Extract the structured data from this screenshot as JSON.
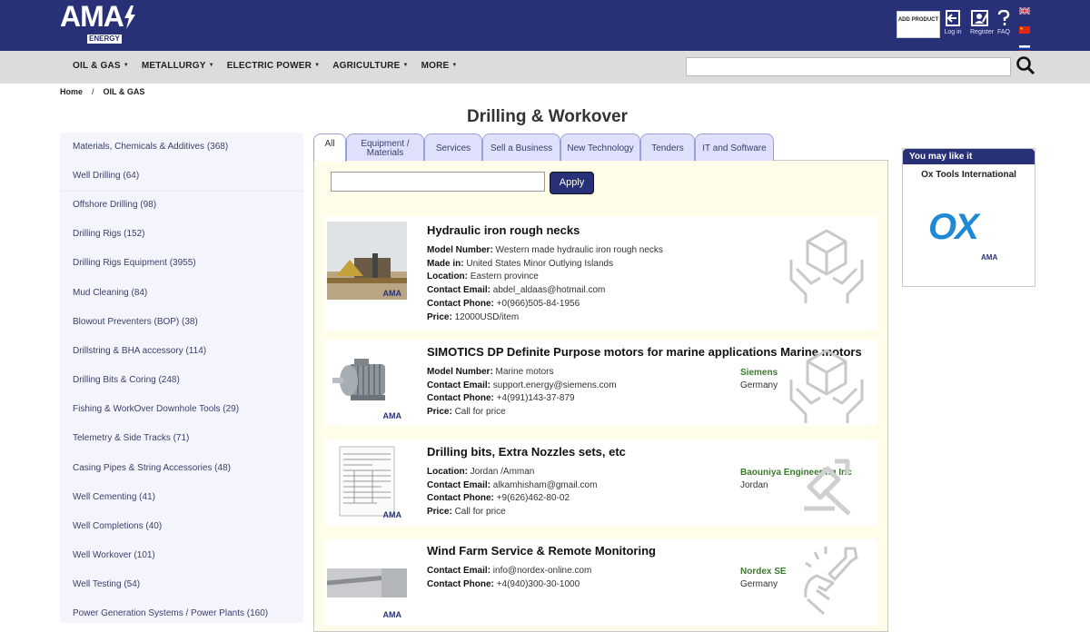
{
  "header": {
    "logo_text": "AMA",
    "logo_sub": "ENERGY",
    "add_product_label": "ADD PRODUCT",
    "login_label": "Log in",
    "register_label": "Register",
    "faq_label": "FAQ",
    "flags": [
      "uk-flag",
      "china-flag",
      "russia-flag"
    ],
    "brand_color": "#283177"
  },
  "nav": {
    "items": [
      "OIL & GAS",
      "METALLURGY",
      "ELECTRIC POWER",
      "AGRICULTURE",
      "MORE"
    ],
    "search_placeholder": ""
  },
  "breadcrumb": {
    "home": "Home",
    "sep": "/",
    "current": "OIL & GAS"
  },
  "page": {
    "title": "Drilling & Workover"
  },
  "sidebar": {
    "items": [
      "Materials, Chemicals & Additives (368)",
      "Well Drilling (64)",
      "Offshore Drilling (98)",
      "Drilling Rigs (152)",
      "Drilling Rigs Equipment (3955)",
      "Mud Cleaning (84)",
      "Blowout Preventers (BOP) (38)",
      "Drillstring & BHA accessory (114)",
      "Drilling Bits & Coring (248)",
      "Fishing & WorkOver Downhole Tools (29)",
      "Telemetry & Side Tracks (71)",
      "Casing Pipes & String Accessories (48)",
      "Well Cementing (41)",
      "Well Completions (40)",
      "Well Workover (101)",
      "Well Testing (54)",
      "Power Generation Systems / Power Plants (160)"
    ]
  },
  "tabs": [
    {
      "label": "All"
    },
    {
      "label": "Equipment / Materials"
    },
    {
      "label": "Services"
    },
    {
      "label": "Sell a Business"
    },
    {
      "label": "New Technology"
    },
    {
      "label": "Tenders"
    },
    {
      "label": "IT and Software"
    }
  ],
  "filter": {
    "placeholder": "",
    "apply_label": "Apply"
  },
  "listings": [
    {
      "title": "Hydraulic iron rough necks",
      "fields": [
        {
          "k": "Model Number:",
          "v": " Western made hydraulic iron rough necks"
        },
        {
          "k": "Made in:",
          "v": " United States Minor Outlying Islands"
        },
        {
          "k": "Location:",
          "v": " Eastern province"
        },
        {
          "k": "Contact Email:",
          "v": " abdel_aldaas@hotmail.com"
        },
        {
          "k": "Contact Phone:",
          "v": " +0(966)505-84-1956"
        },
        {
          "k": "Price:",
          "v": " 12000USD/item"
        }
      ],
      "company": "",
      "country": "",
      "icon": "box-in-hands-icon"
    },
    {
      "title": "SIMOTICS DP Definite Purpose motors for marine applications Marine motors",
      "fields": [
        {
          "k": "Model Number:",
          "v": " Marine motors"
        },
        {
          "k": "Contact Email:",
          "v": " support.energy@siemens.com"
        },
        {
          "k": "Contact Phone:",
          "v": " +4(991)143-37-879"
        },
        {
          "k": "Price:",
          "v": " Call for price"
        }
      ],
      "company": "Siemens",
      "country": "Germany",
      "icon": "box-in-hands-icon"
    },
    {
      "title": "Drilling bits, Extra Nozzles sets, etc",
      "fields": [
        {
          "k": "Location:",
          "v": " Jordan /Amman"
        },
        {
          "k": "Contact Email:",
          "v": " alkamhisham@gmail.com"
        },
        {
          "k": "Contact Phone:",
          "v": " +9(626)462-80-02"
        },
        {
          "k": "Price:",
          "v": " Call for price"
        }
      ],
      "company": "Baouniya Engineering Inc",
      "country": "Jordan",
      "icon": "hammer-arrow-icon"
    },
    {
      "title": "Wind Farm Service & Remote Monitoring",
      "fields": [
        {
          "k": "Contact Email:",
          "v": " info@nordex-online.com"
        },
        {
          "k": "Contact Phone:",
          "v": " +4(940)300-30-1000"
        }
      ],
      "company": "Nordex SE",
      "country": "Germany",
      "icon": "wrench-hand-icon"
    }
  ],
  "thumb_mark": "AMA",
  "ad": {
    "header": "You may like it",
    "company": "Ox Tools International",
    "logo_text": "OX",
    "mark": "AMA"
  }
}
